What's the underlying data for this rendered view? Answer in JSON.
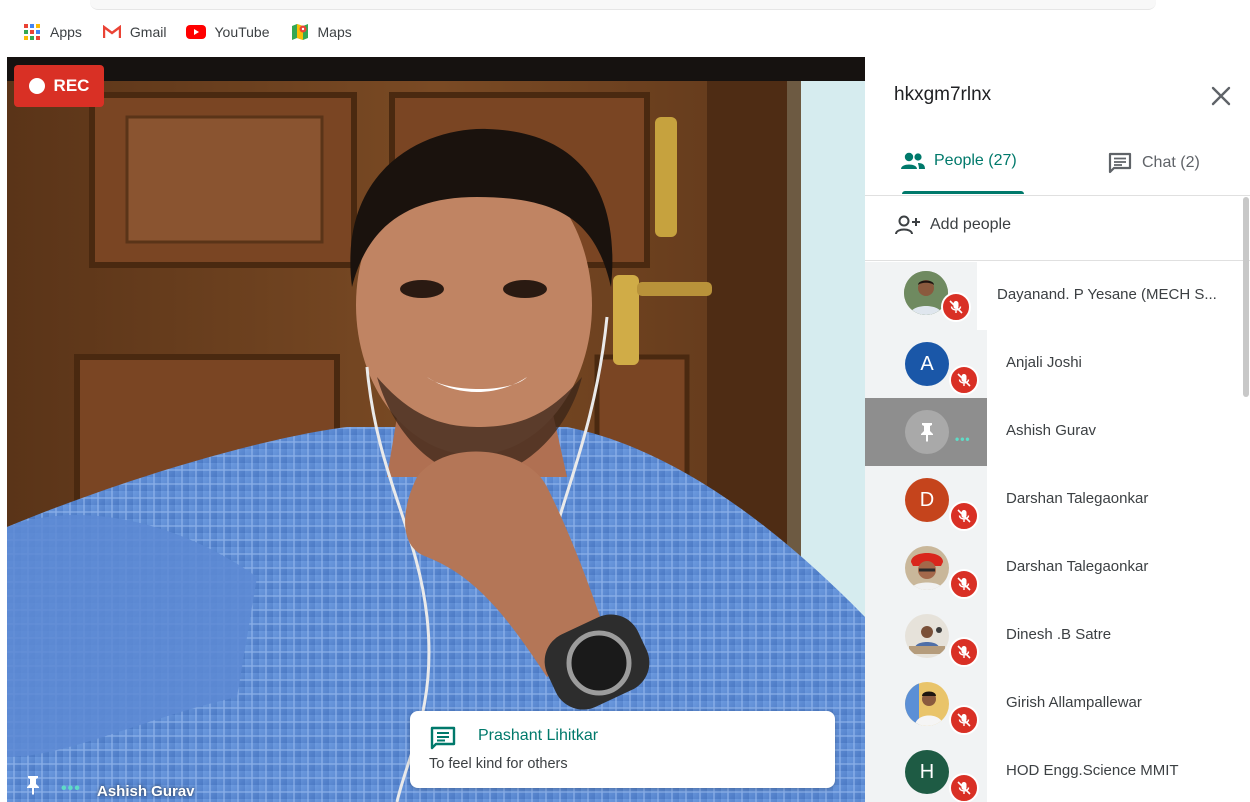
{
  "bookmarks": [
    {
      "label": "Apps",
      "icon": "apps-grid-icon"
    },
    {
      "label": "Gmail",
      "icon": "gmail-icon"
    },
    {
      "label": "YouTube",
      "icon": "youtube-icon"
    },
    {
      "label": "Maps",
      "icon": "maps-icon"
    }
  ],
  "video": {
    "rec_label": "REC",
    "presenter_name": "Ashish Gurav",
    "more_label": "•••"
  },
  "toast": {
    "sender": "Prashant Lihitkar",
    "message": "To feel kind for others"
  },
  "panel": {
    "meeting_code": "hkxgm7rlnx",
    "tabs": {
      "people": "People (27)",
      "chat": "Chat (2)"
    },
    "add_people": "Add people"
  },
  "participants": [
    {
      "name": "Dayanand. P Yesane (MECH S...",
      "avatar": "photo",
      "muted": true
    },
    {
      "name": "Anjali Joshi",
      "avatar_letter": "A",
      "avatar_color": "#1a57a8",
      "muted": true
    },
    {
      "name": "Ashish Gurav",
      "avatar": "pinned",
      "muted": false
    },
    {
      "name": "Darshan Talegaonkar",
      "avatar_letter": "D",
      "avatar_color": "#c5441c",
      "muted": true
    },
    {
      "name": "Darshan Talegaonkar",
      "avatar": "photo",
      "muted": true
    },
    {
      "name": "Dinesh .B Satre",
      "avatar": "photo",
      "muted": true
    },
    {
      "name": "Girish Allampallewar",
      "avatar": "photo",
      "muted": true
    },
    {
      "name": "HOD Engg.Science MMIT",
      "avatar_letter": "H",
      "avatar_color": "#1e5b44",
      "muted": true
    }
  ],
  "colors": {
    "accent": "#00796b",
    "mute_red": "#d93025",
    "rec_red": "#d93025"
  }
}
